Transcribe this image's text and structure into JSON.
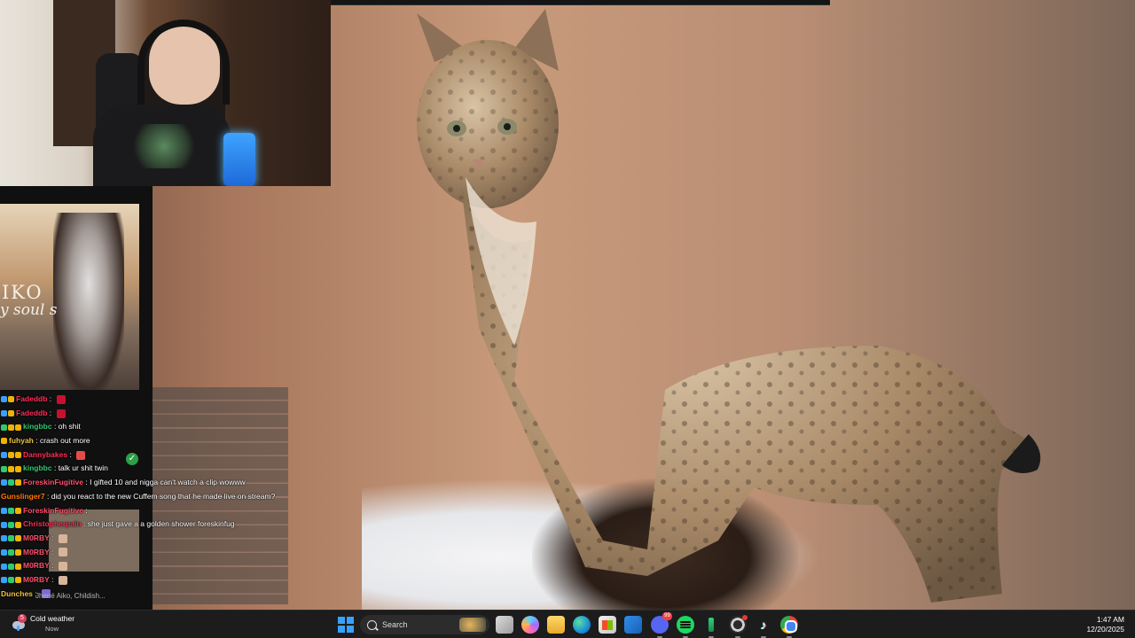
{
  "webcam": {},
  "album": {
    "title": "IKO",
    "subtitle": "y soul s"
  },
  "chat": {
    "messages": [
      {
        "name": "Fadeddb",
        "name_color": "#ff2d55",
        "text": "",
        "badges": [
          "#3aa0ff",
          "#f0b400"
        ],
        "emote": "#c8102e"
      },
      {
        "name": "Fadeddb",
        "name_color": "#ff2d55",
        "text": "",
        "badges": [
          "#3aa0ff",
          "#f0b400"
        ],
        "emote": "#c8102e"
      },
      {
        "name": "kingbbc",
        "name_color": "#2ecc71",
        "text": "oh shit",
        "badges": [
          "#2ecc71",
          "#f0b400",
          "#f0b400"
        ],
        "emote": null
      },
      {
        "name": "fuhyah",
        "name_color": "#f0c23b",
        "text": "crash out more",
        "badges": [
          "#f0b400"
        ],
        "emote": null
      },
      {
        "name": "Dannybakes",
        "name_color": "#ff2d55",
        "text": "",
        "badges": [
          "#3aa0ff",
          "#f0b400",
          "#f0b400"
        ],
        "emote": "#e34b4b"
      },
      {
        "name": "kingbbc",
        "name_color": "#2ecc71",
        "text": "talk ur shit twin",
        "badges": [
          "#2ecc71",
          "#f0b400",
          "#f0b400"
        ],
        "emote": null
      },
      {
        "name": "ForeskinFugitive",
        "name_color": "#ff4f6b",
        "text": "I gifted 10 and nigga can't watch a clip wowww",
        "badges": [
          "#3aa0ff",
          "#2ecc71",
          "#f0b400"
        ],
        "emote": null
      },
      {
        "name": "Gunslinger7",
        "name_color": "#ff7a00",
        "text": "did you react to the new Cuffem song that he made live on stream?",
        "badges": [],
        "emote": null
      },
      {
        "name": "ForeskinFugitive",
        "name_color": "#ff4f6b",
        "text": "",
        "badges": [
          "#3aa0ff",
          "#2ecc71",
          "#f0b400"
        ],
        "emote": null
      },
      {
        "name": "Christopherpain",
        "name_color": "#ff2d55",
        "text": "she just gave a a golden shower foreskinfug",
        "badges": [
          "#3aa0ff",
          "#2ecc71",
          "#f0b400"
        ],
        "emote": null
      },
      {
        "name": "M0RBY",
        "name_color": "#ff4f6b",
        "text": "",
        "badges": [
          "#3aa0ff",
          "#2ecc71",
          "#f0b400"
        ],
        "emote": "#d8b49a"
      },
      {
        "name": "M0RBY",
        "name_color": "#ff4f6b",
        "text": "",
        "badges": [
          "#3aa0ff",
          "#2ecc71",
          "#f0b400"
        ],
        "emote": "#d8b49a"
      },
      {
        "name": "M0RBY",
        "name_color": "#ff4f6b",
        "text": "",
        "badges": [
          "#3aa0ff",
          "#2ecc71",
          "#f0b400"
        ],
        "emote": "#d8b49a"
      },
      {
        "name": "M0RBY",
        "name_color": "#ff4f6b",
        "text": "",
        "badges": [
          "#3aa0ff",
          "#2ecc71",
          "#f0b400"
        ],
        "emote": "#d8b49a"
      },
      {
        "name": "Dunches",
        "name_color": "#f0c23b",
        "text": "",
        "badges": [],
        "emote": "#7a6bd6"
      }
    ],
    "input_preview": "Jhené Aiko, Childish..."
  },
  "taskbar": {
    "weather": {
      "label": "Cold weather",
      "sub": "Now",
      "notification_count": "5"
    },
    "search": {
      "placeholder": "Search"
    },
    "apps": [
      "task-view",
      "copilot",
      "file-explorer",
      "edge",
      "microsoft-store",
      "mail",
      "discord",
      "spotify",
      "game-launcher",
      "obs",
      "tiktok",
      "chrome"
    ],
    "discord_badge": "99",
    "clock": {
      "time": "1:47 AM",
      "date": "12/20/2025"
    }
  },
  "colors": {
    "taskbar": "#1c1c1c",
    "accent": "#3aa0ff"
  }
}
